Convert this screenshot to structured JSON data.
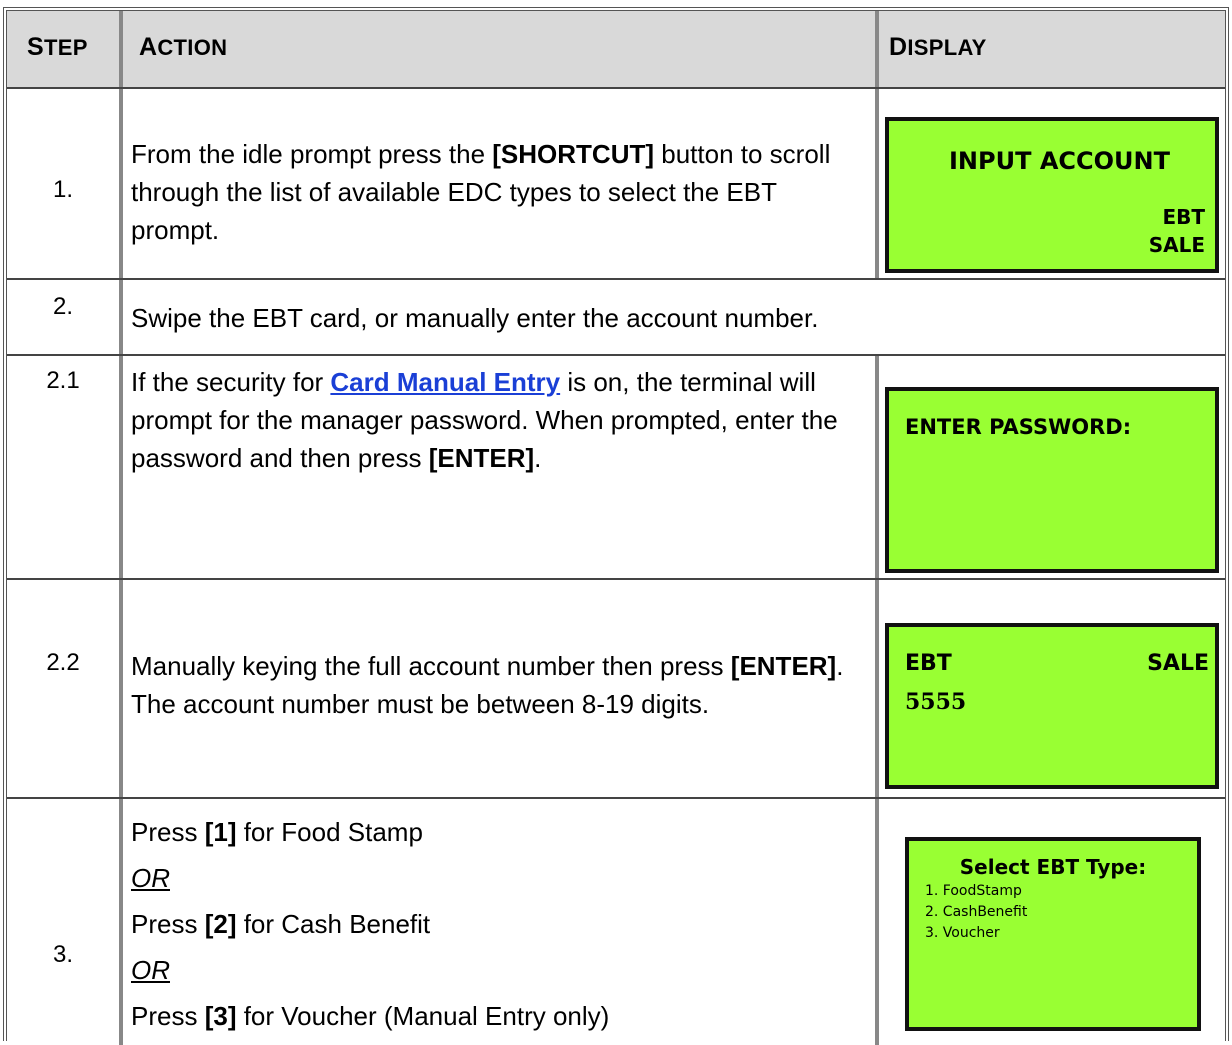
{
  "header": {
    "step": "Step",
    "action": "Action",
    "display": "Display"
  },
  "rows": [
    {
      "step": "1.",
      "action_parts": [
        "From the idle prompt press the ",
        "[SHORTCUT]",
        " button to scroll through the list of available EDC types to select the EBT prompt."
      ],
      "display": {
        "line1": "INPUT ACCOUNT",
        "line2": "EBT",
        "line3": "SALE"
      }
    },
    {
      "step": "2.",
      "action": "Swipe the EBT card, or manually enter the account number."
    },
    {
      "step": "2.1",
      "action_parts": [
        "If the security for ",
        "Card Manual Entry",
        " is on, the terminal will prompt for the manager password. When prompted, enter the password and then press ",
        "[ENTER]",
        "."
      ],
      "display": {
        "line1": "ENTER PASSWORD:"
      }
    },
    {
      "step": "2.2",
      "action_parts": [
        "Manually keying the full account number then press ",
        "[ENTER]",
        ". The account number must be between 8-19 digits."
      ],
      "display": {
        "left": "EBT",
        "right": "SALE",
        "line2": "5555"
      }
    },
    {
      "step": "3.",
      "lines": [
        {
          "key": "[1]",
          "text": " for Food Stamp"
        },
        {
          "or": "OR"
        },
        {
          "key": "[2]",
          "text": " for Cash Benefit"
        },
        {
          "or": "OR"
        },
        {
          "key": "[3]",
          "text": " for Voucher (Manual Entry only)"
        }
      ],
      "press": "Press",
      "display": {
        "title": "Select EBT Type:",
        "items": [
          "1. FoodStamp",
          "2. CashBenefit",
          "3. Voucher"
        ]
      }
    }
  ],
  "colors": {
    "lcd": "#99ff33",
    "header": "#d9d9d9",
    "link": "#1a3fd6"
  }
}
